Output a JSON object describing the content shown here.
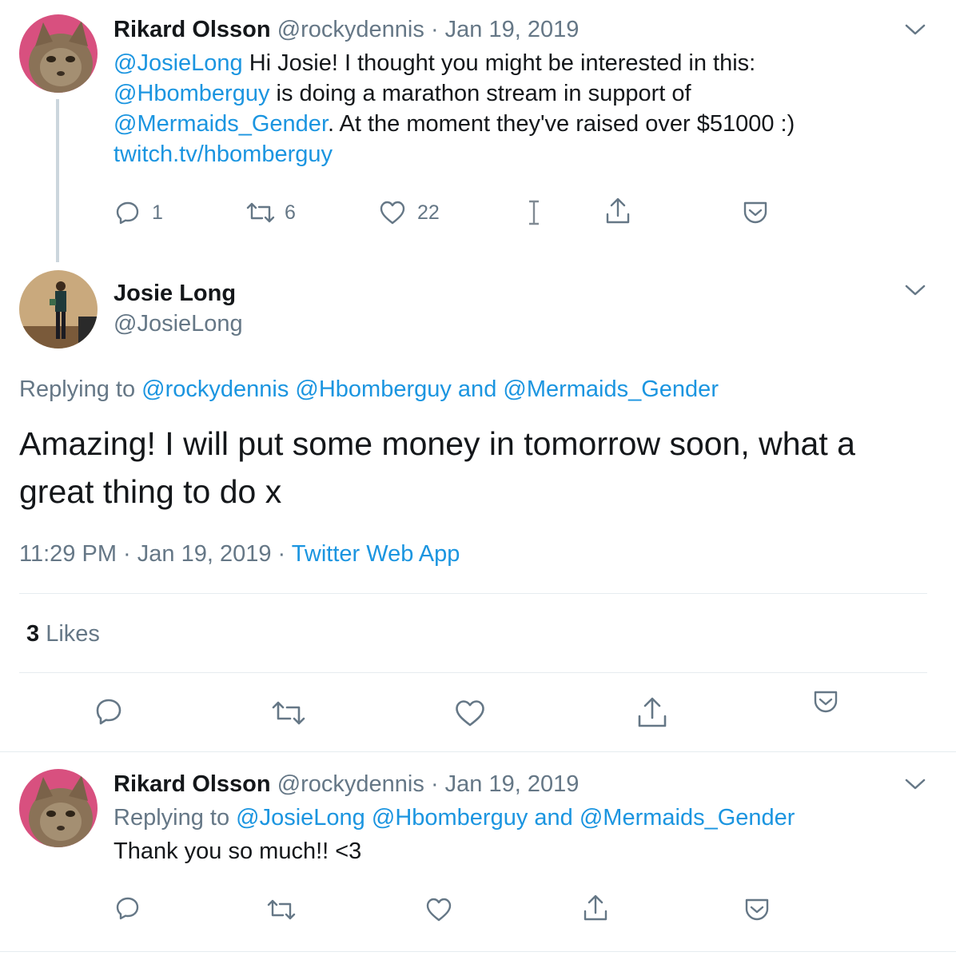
{
  "tweet1": {
    "name": "Rikard Olsson",
    "handle": "@rockydennis",
    "sep": "·",
    "date": "Jan 19, 2019",
    "text": {
      "m1": "@JosieLong",
      "t1": " Hi Josie! I thought you might be interested in this:",
      "m2": "@Hbomberguy",
      "t2": " is doing a marathon stream in support of",
      "m3": "@Mermaids_Gender",
      "t3": ". At the moment they've raised over $51000 :)",
      "url": "twitch.tv/hbomberguy"
    },
    "replies": "1",
    "retweets": "6",
    "likes": "22"
  },
  "main": {
    "name": "Josie Long",
    "handle": "@JosieLong",
    "replying_prefix": "Replying to ",
    "reply_to_1": "@rockydennis",
    "reply_to_2": "@Hbomberguy",
    "reply_and": " and ",
    "reply_to_3": "@Mermaids_Gender",
    "text": "Amazing! I will put some money in tomorrow soon, what a great thing to do x",
    "time": "11:29 PM",
    "sep": "·",
    "date": "Jan 19, 2019",
    "client": "Twitter Web App",
    "likes_count": "3",
    "likes_label": "Likes"
  },
  "tweet2": {
    "name": "Rikard Olsson",
    "handle": "@rockydennis",
    "sep": "·",
    "date": "Jan 19, 2019",
    "replying_prefix": "Replying to ",
    "reply_to_1": "@JosieLong",
    "reply_to_2": "@Hbomberguy",
    "reply_and": " and ",
    "reply_to_3": "@Mermaids_Gender",
    "text": "Thank you so much!! <3"
  },
  "colors": {
    "link": "#1b95e0",
    "secondary": "#657786",
    "divider": "#e6ecf0",
    "text": "#14171a"
  },
  "icons": [
    "reply-icon",
    "retweet-icon",
    "like-icon",
    "text-cursor-icon",
    "share-icon",
    "pocket-icon",
    "chevron-down-icon"
  ]
}
